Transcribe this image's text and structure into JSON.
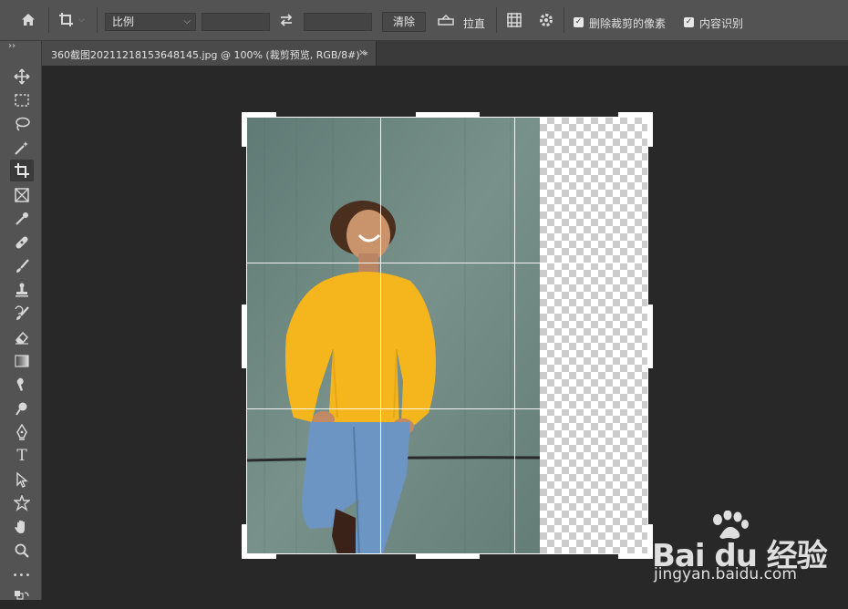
{
  "options_bar": {
    "home_icon": "home-icon",
    "crop_tool_icon": "crop-icon",
    "ratio_select_value": "比例",
    "width_value": "",
    "height_value": "",
    "swap_icon": "swap-arrows-icon",
    "clear_label": "清除",
    "straighten_label": "拉直",
    "grid_overlay_icon": "grid-overlay-icon",
    "settings_icon": "gear-icon",
    "delete_cropped_pixels_label": "删除裁剪的像素",
    "delete_cropped_pixels_checked": true,
    "content_aware_label": "内容识别",
    "content_aware_checked": true
  },
  "document_tab": {
    "title": "360截图20211218153648145.jpg @ 100% (裁剪预览, RGB/8#) *",
    "close_glyph": "×"
  },
  "toolbar": {
    "collapse_glyph": "››",
    "tools": [
      "move-tool",
      "rect-marquee-tool",
      "lasso-tool",
      "magic-wand-tool",
      "crop-tool",
      "frame-tool",
      "eyedropper-tool",
      "healing-brush-tool",
      "brush-tool",
      "clone-stamp-tool",
      "history-brush-tool",
      "eraser-tool",
      "gradient-tool",
      "smudge-tool",
      "dodge-tool",
      "pen-tool",
      "type-tool",
      "path-selection-tool",
      "custom-shape-tool",
      "hand-tool",
      "zoom-tool",
      "more-tools"
    ],
    "active_tool": "crop-tool",
    "type_tool_glyph": "T",
    "more_glyph": "•••"
  },
  "watermark": {
    "main": "Bai du 经验",
    "sub": "jingyan.baidu.com"
  },
  "colors": {
    "options_bar_bg": "#535353",
    "canvas_bg": "#282828",
    "sweater": "#f5b51c",
    "wall": "#6f8a83",
    "jeans": "#6d95c4"
  }
}
